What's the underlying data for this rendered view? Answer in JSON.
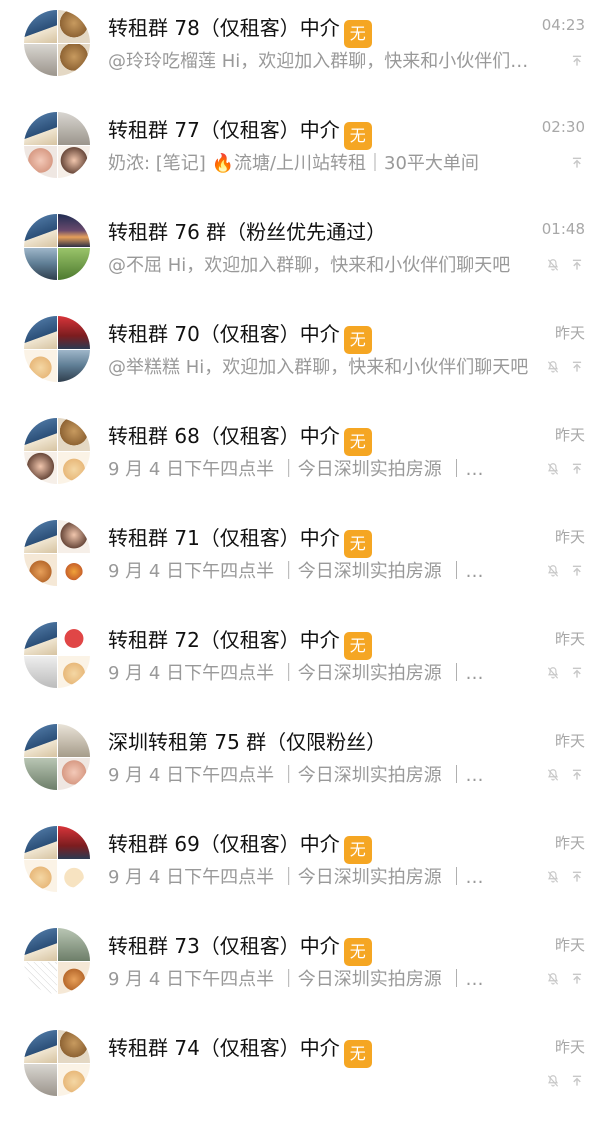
{
  "chats": [
    {
      "name": "转租群 78（仅租客）中介",
      "badge": "无",
      "time": "04:23",
      "preview": "@玲玲吃榴莲 Hi，欢迎加入群聊，快来和小伙伴们…",
      "muted": false,
      "tiles": [
        "t-blue",
        "t-dog",
        "t-grey",
        "t-dog"
      ]
    },
    {
      "name": "转租群 77（仅租客）中介",
      "badge": "无",
      "time": "02:30",
      "preview": "奶浓: [笔记] 🔥流塘/上川站转租｜30平大单间",
      "muted": false,
      "tiles": [
        "t-blue",
        "t-grey",
        "t-pink",
        "t-face"
      ]
    },
    {
      "name": "转租群 76 群（粉丝优先通过）",
      "badge": "",
      "time": "01:48",
      "preview": "@不屈 Hi，欢迎加入群聊，快来和小伙伴们聊天吧",
      "muted": true,
      "tiles": [
        "t-blue",
        "t-sky",
        "t-sea",
        "t-green"
      ]
    },
    {
      "name": "转租群 70（仅租客）中介",
      "badge": "无",
      "time": "昨天",
      "preview": "@举糕糕 Hi，欢迎加入群聊，快来和小伙伴们聊天吧",
      "muted": true,
      "tiles": [
        "t-blue",
        "t-red",
        "t-cream",
        "t-sea"
      ]
    },
    {
      "name": "转租群 68（仅租客）中介",
      "badge": "无",
      "time": "昨天",
      "preview": "9 月 4 日下午四点半 ｜今日深圳实拍房源 ｜…",
      "muted": true,
      "tiles": [
        "t-blue",
        "t-dog",
        "t-face",
        "t-cream"
      ]
    },
    {
      "name": "转租群 71（仅租客）中介",
      "badge": "无",
      "time": "昨天",
      "preview": "9 月 4 日下午四点半 ｜今日深圳实拍房源 ｜…",
      "muted": true,
      "tiles": [
        "t-blue",
        "t-face",
        "t-fox",
        "t-pizza"
      ]
    },
    {
      "name": "转租群 72（仅租客）中介",
      "badge": "无",
      "time": "昨天",
      "preview": "9 月 4 日下午四点半 ｜今日深圳实拍房源 ｜…",
      "muted": true,
      "tiles": [
        "t-blue",
        "t-heart",
        "t-cap",
        "t-cream"
      ]
    },
    {
      "name": "深圳转租第 75 群（仅限粉丝）",
      "badge": "",
      "time": "昨天",
      "preview": "9 月 4 日下午四点半 ｜今日深圳实拍房源 ｜…",
      "muted": true,
      "tiles": [
        "t-blue",
        "t-room",
        "t-lake",
        "t-pink"
      ]
    },
    {
      "name": "转租群 69（仅租客）中介",
      "badge": "无",
      "time": "昨天",
      "preview": "9 月 4 日下午四点半 ｜今日深圳实拍房源 ｜…",
      "muted": true,
      "tiles": [
        "t-blue",
        "t-red",
        "t-cream",
        "t-bunny"
      ]
    },
    {
      "name": "转租群 73（仅租客）中介",
      "badge": "无",
      "time": "昨天",
      "preview": "9 月 4 日下午四点半 ｜今日深圳实拍房源 ｜…",
      "muted": true,
      "tiles": [
        "t-blue",
        "t-lake",
        "t-sketch",
        "t-fox"
      ]
    },
    {
      "name": "转租群 74（仅租客）中介",
      "badge": "无",
      "time": "昨天",
      "preview": "",
      "muted": true,
      "tiles": [
        "t-blue",
        "t-dog",
        "t-grey",
        "t-cream"
      ]
    }
  ],
  "icons": {
    "mute": "bell-off-icon",
    "pin": "pin-top-icon"
  },
  "colors": {
    "badge": "#f5a623",
    "secondary_text": "#999999",
    "time_text": "#a8a8a8"
  }
}
